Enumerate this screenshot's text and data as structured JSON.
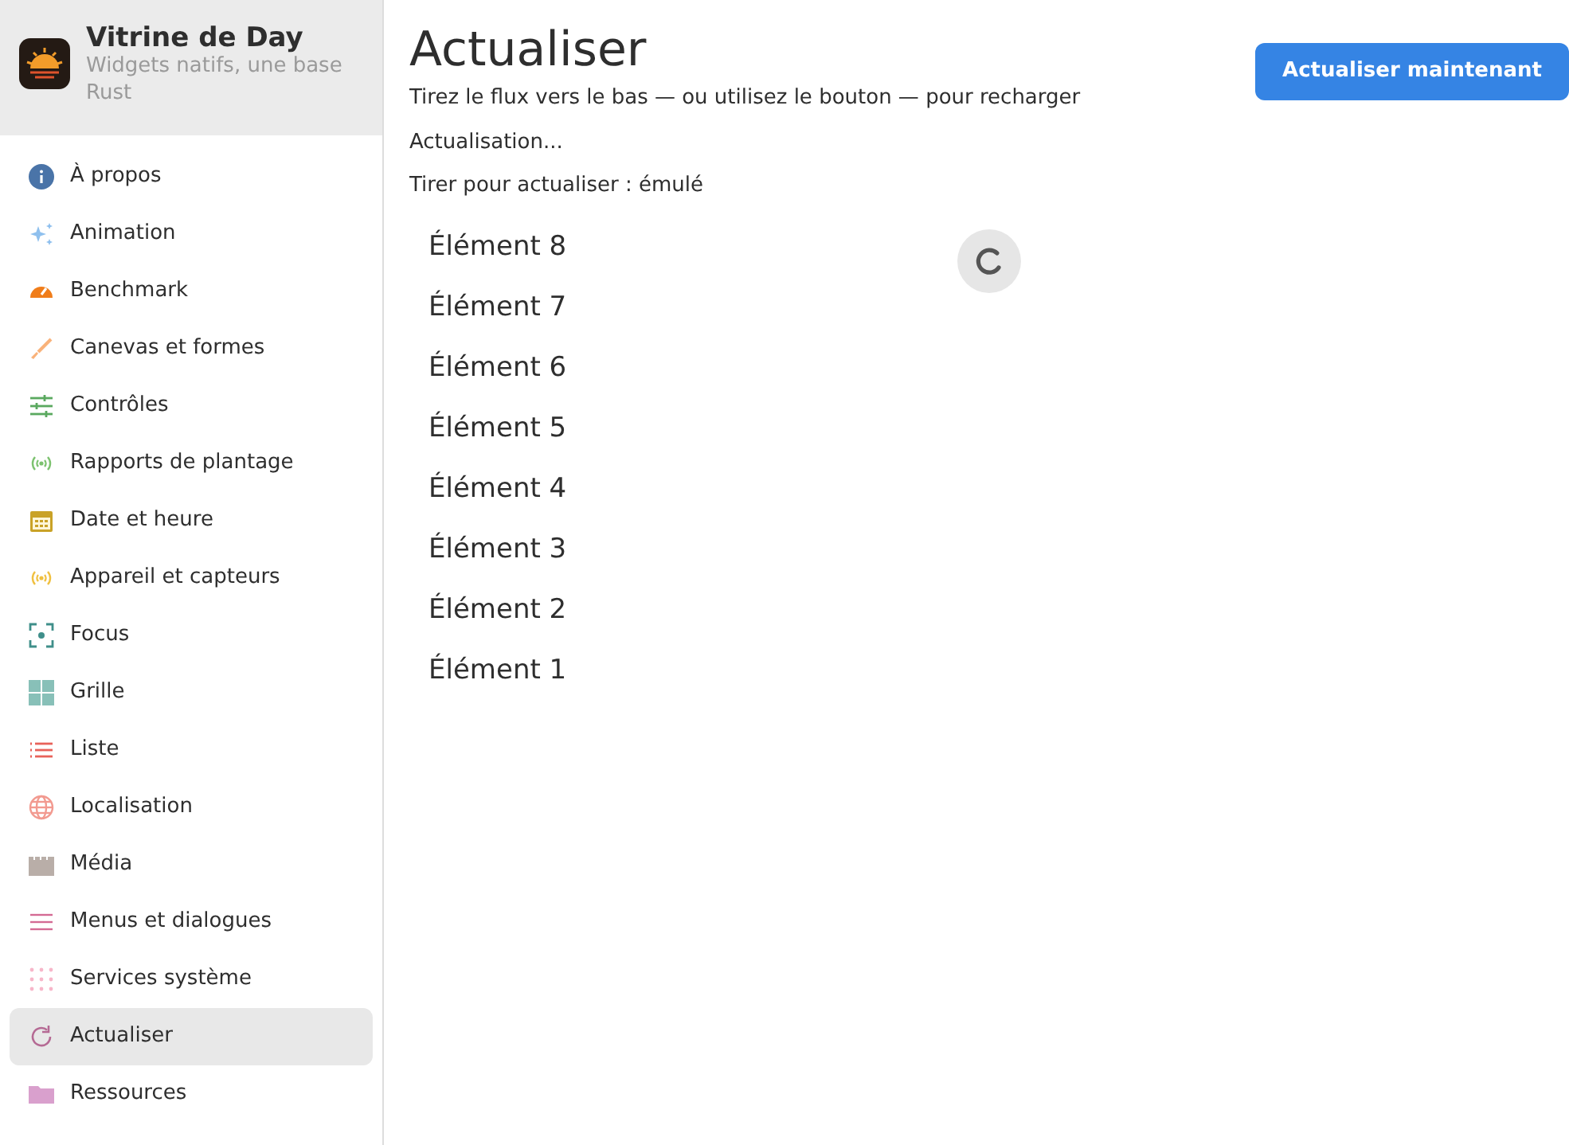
{
  "app": {
    "title": "Vitrine de Day",
    "subtitle": "Widgets natifs, une base Rust"
  },
  "sidebar": {
    "items": [
      {
        "label": "À propos",
        "selected": false
      },
      {
        "label": "Animation",
        "selected": false
      },
      {
        "label": "Benchmark",
        "selected": false
      },
      {
        "label": "Canevas et formes",
        "selected": false
      },
      {
        "label": "Contrôles",
        "selected": false
      },
      {
        "label": "Rapports de plantage",
        "selected": false
      },
      {
        "label": "Date et heure",
        "selected": false
      },
      {
        "label": "Appareil et capteurs",
        "selected": false
      },
      {
        "label": "Focus",
        "selected": false
      },
      {
        "label": "Grille",
        "selected": false
      },
      {
        "label": "Liste",
        "selected": false
      },
      {
        "label": "Localisation",
        "selected": false
      },
      {
        "label": "Média",
        "selected": false
      },
      {
        "label": "Menus et dialogues",
        "selected": false
      },
      {
        "label": "Services système",
        "selected": false
      },
      {
        "label": "Actualiser",
        "selected": true
      },
      {
        "label": "Ressources",
        "selected": false
      }
    ]
  },
  "main": {
    "title": "Actualiser",
    "subtitle": "Tirez le flux vers le bas — ou utilisez le bouton — pour recharger",
    "status": "Actualisation...",
    "mode": "Tirer pour actualiser : émulé",
    "refreshing": true,
    "button": "Actualiser maintenant",
    "items": [
      "Élément 8",
      "Élément 7",
      "Élément 6",
      "Élément 5",
      "Élément 4",
      "Élément 3",
      "Élément 2",
      "Élément 1"
    ]
  }
}
